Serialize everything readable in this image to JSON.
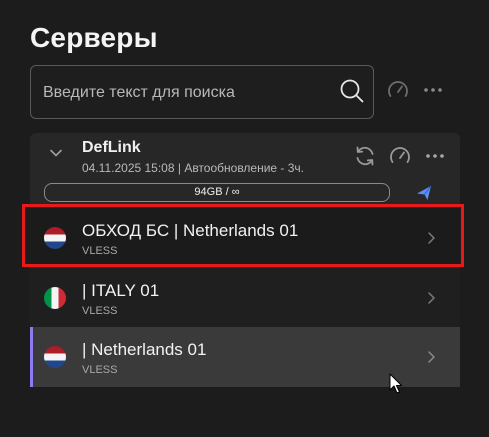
{
  "page": {
    "title": "Серверы"
  },
  "search": {
    "placeholder": "Введите текст для поиска",
    "value": ""
  },
  "subscription": {
    "name": "DefLink",
    "meta": "04.11.2025 15:08 | Автообновление - 3ч.",
    "traffic": "94GB / ∞"
  },
  "servers": [
    {
      "name": "ОБХОД БС | Netherlands 01",
      "protocol": "VLESS",
      "flag": "netherlands"
    },
    {
      "name": "| ITALY 01",
      "protocol": "VLESS",
      "flag": "italy"
    },
    {
      "name": "| Netherlands 01",
      "protocol": "VLESS",
      "flag": "netherlands",
      "active": true
    }
  ],
  "icons": {
    "search": "search-icon",
    "speed": "speedometer-icon",
    "more": "more-horizontal-icon",
    "refresh": "refresh-icon",
    "send": "send-icon",
    "expand": "chevron-down-icon",
    "open": "chevron-right-icon"
  },
  "colors": {
    "background": "#1c1c1c",
    "panel": "#272727",
    "active_row": "#3a3a3a",
    "active_accent": "#8d7cf0",
    "send_accent": "#5b8ef7",
    "highlight": "#e81919"
  }
}
